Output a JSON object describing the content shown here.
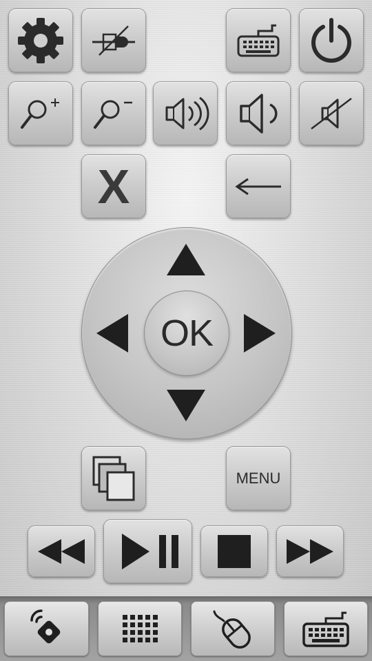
{
  "top_row": {
    "settings": {
      "icon": "gear-icon"
    },
    "disconnect": {
      "icon": "plug-crossed-icon"
    },
    "keyboard": {
      "icon": "keyboard-icon"
    },
    "power": {
      "icon": "power-icon"
    }
  },
  "second_row": {
    "zoom_in": {
      "icon": "zoom-in-icon"
    },
    "zoom_out": {
      "icon": "zoom-out-icon"
    },
    "volume_up": {
      "icon": "volume-up-icon"
    },
    "volume_down": {
      "icon": "volume-down-icon"
    },
    "mute": {
      "icon": "mute-icon"
    }
  },
  "third_row": {
    "close_label": "X",
    "back": {
      "icon": "back-arrow-icon"
    }
  },
  "dpad": {
    "ok_label": "OK"
  },
  "fourth_row": {
    "windows": {
      "icon": "windows-icon"
    },
    "menu_label": "MENU"
  },
  "media": {
    "rewind": {
      "icon": "rewind-icon"
    },
    "play_pause": {
      "icon": "play-pause-icon"
    },
    "stop": {
      "icon": "stop-icon"
    },
    "fast_forward": {
      "icon": "fast-forward-icon"
    }
  },
  "bottom_nav": [
    {
      "icon": "remote-icon"
    },
    {
      "icon": "numpad-icon"
    },
    {
      "icon": "mouse-icon"
    },
    {
      "icon": "keyboard-icon"
    }
  ],
  "colors": {
    "icon": "#2b2b2b",
    "button_top": "#e2e2e2",
    "button_bottom": "#b7b7b7"
  }
}
